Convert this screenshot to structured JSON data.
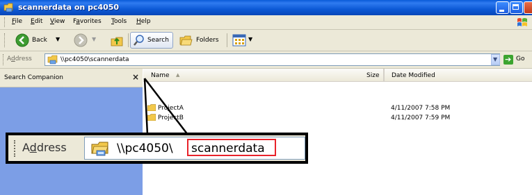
{
  "window": {
    "title": "scannerdata on pc4050",
    "icon": "network-folder-icon",
    "controls": [
      "minimize",
      "maximize",
      "close"
    ]
  },
  "menu": {
    "items": [
      {
        "pre": "",
        "u": "F",
        "post": "ile"
      },
      {
        "pre": "",
        "u": "E",
        "post": "dit"
      },
      {
        "pre": "",
        "u": "V",
        "post": "iew"
      },
      {
        "pre": "F",
        "u": "a",
        "post": "vorites"
      },
      {
        "pre": "",
        "u": "T",
        "post": "ools"
      },
      {
        "pre": "",
        "u": "H",
        "post": "elp"
      }
    ]
  },
  "toolbar": {
    "back_label": "Back",
    "search_label": "Search",
    "folders_label": "Folders"
  },
  "address": {
    "label_pre": "A",
    "label_u": "d",
    "label_post": "dress",
    "value": "\\\\pc4050\\scannerdata",
    "go_label": "Go"
  },
  "companion": {
    "title": "Search Companion",
    "close_glyph": "×"
  },
  "filelist": {
    "columns": {
      "name": "Name",
      "size": "Size",
      "date": "Date Modified"
    },
    "rows": [
      {
        "name": "ProjectA",
        "date": "4/11/2007 7:58 PM"
      },
      {
        "name": "ProjectB",
        "date": "4/11/2007 7:59 PM"
      }
    ]
  },
  "callout": {
    "label_pre": "A",
    "label_u": "d",
    "label_post": "dress",
    "path_prefix": "\\\\pc4050\\",
    "path_highlight": "scannerdata"
  },
  "colors": {
    "titlebar": "#0a5bd8",
    "chrome": "#ece9d8",
    "companion_bg": "#7c9ee6",
    "highlight_border": "#e8222a"
  }
}
